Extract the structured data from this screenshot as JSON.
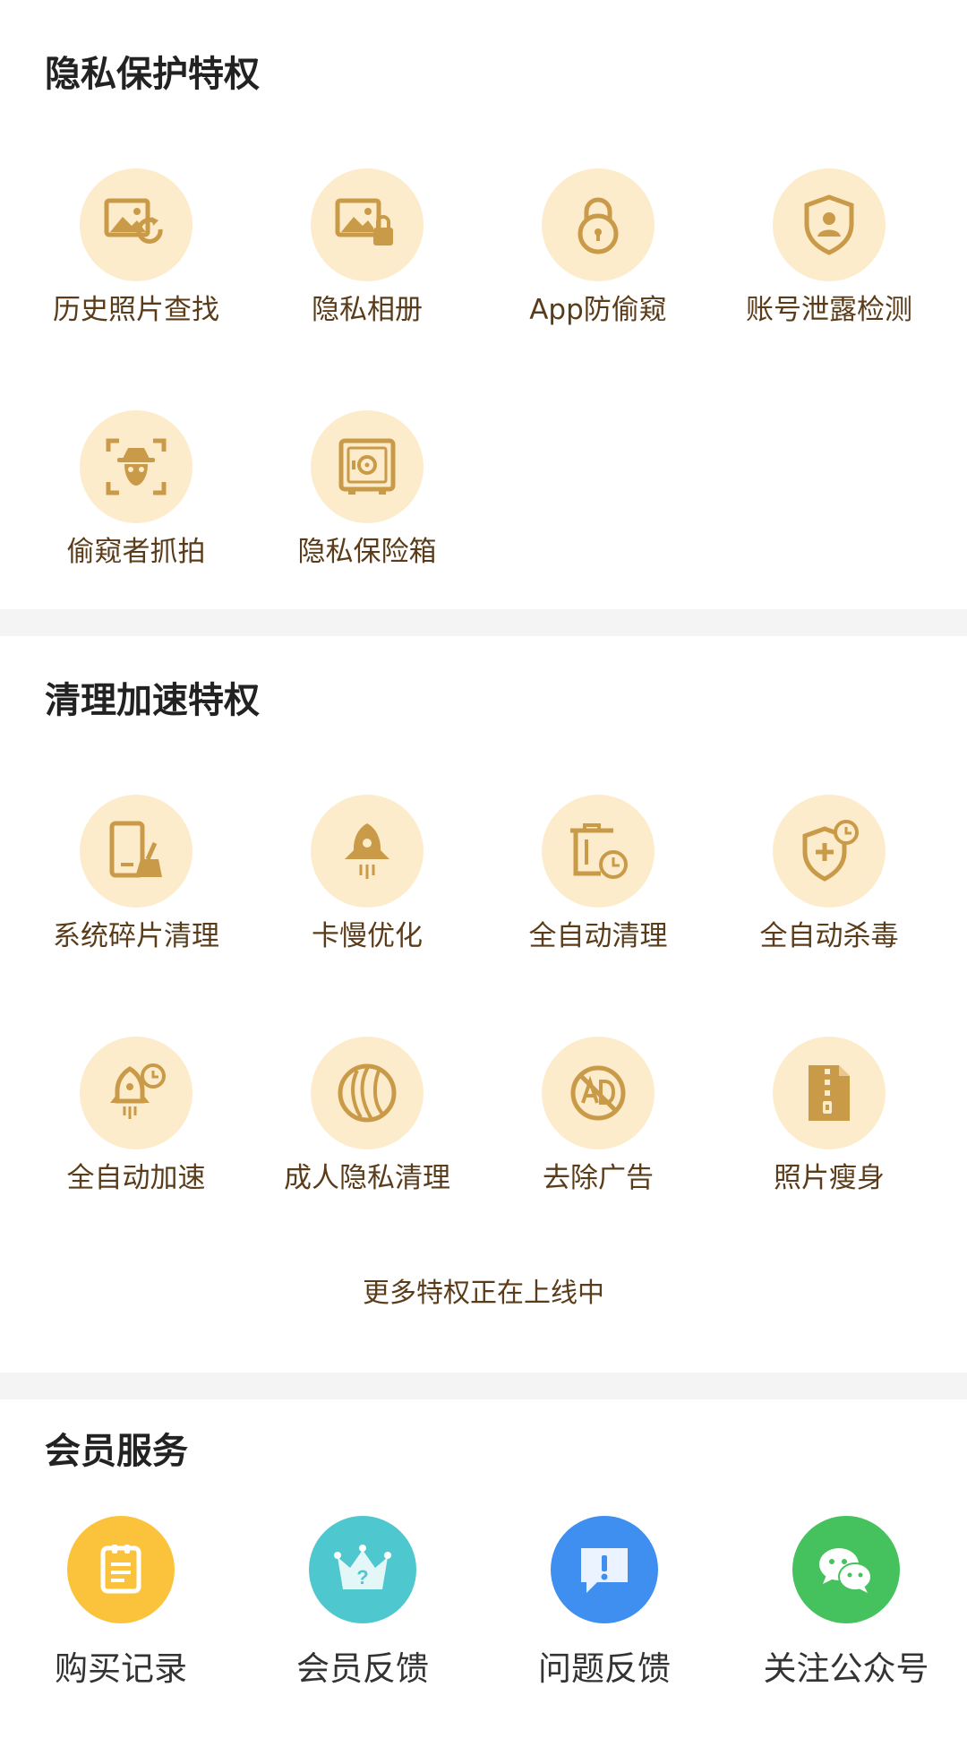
{
  "colors": {
    "accent": "#c99a48",
    "icon_bg": "#fdeccc",
    "label": "#5a3c1a",
    "divider": "#f4f4f4"
  },
  "privacy": {
    "title": "隐私保护特权",
    "items": [
      {
        "label": "历史照片查找",
        "icon": "photo-history-icon"
      },
      {
        "label": "隐私相册",
        "icon": "private-album-icon"
      },
      {
        "label": "App防偷窥",
        "icon": "padlock-icon"
      },
      {
        "label": "账号泄露检测",
        "icon": "account-shield-icon"
      },
      {
        "label": "偷窥者抓拍",
        "icon": "spy-capture-icon"
      },
      {
        "label": "隐私保险箱",
        "icon": "safe-box-icon"
      }
    ]
  },
  "cleanup": {
    "title": "清理加速特权",
    "items": [
      {
        "label": "系统碎片清理",
        "icon": "phone-broom-icon"
      },
      {
        "label": "卡慢优化",
        "icon": "rocket-icon"
      },
      {
        "label": "全自动清理",
        "icon": "trash-clock-icon"
      },
      {
        "label": "全自动杀毒",
        "icon": "shield-plus-clock-icon"
      },
      {
        "label": "全自动加速",
        "icon": "rocket-clock-icon"
      },
      {
        "label": "成人隐私清理",
        "icon": "adult-privacy-icon"
      },
      {
        "label": "去除广告",
        "icon": "no-ad-icon"
      },
      {
        "label": "照片瘦身",
        "icon": "zip-file-icon"
      }
    ],
    "footer": "更多特权正在上线中"
  },
  "member": {
    "title": "会员服务",
    "items": [
      {
        "label": "购买记录",
        "icon": "purchase-notepad-icon",
        "color": "#fbc33c"
      },
      {
        "label": "会员反馈",
        "icon": "crown-question-icon",
        "color": "#4fc7cf"
      },
      {
        "label": "问题反馈",
        "icon": "exclamation-chat-icon",
        "color": "#3f8ff0"
      },
      {
        "label": "关注公众号",
        "icon": "wechat-icon",
        "color": "#45c25e"
      }
    ]
  }
}
